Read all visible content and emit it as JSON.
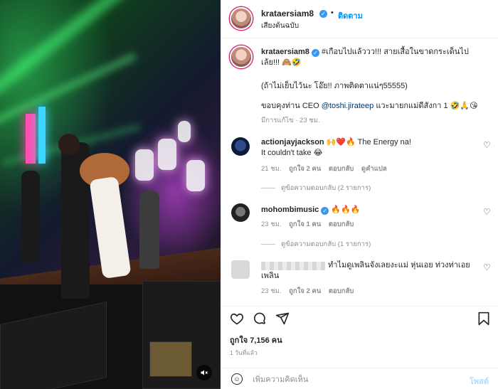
{
  "post": {
    "username": "krataersiam8",
    "follow_label": "ติดตาม",
    "audio_label": "เสียงต้นฉบับ",
    "caption": {
      "username": "krataersiam8",
      "line1": "#เกือบไปแล้ววว!!! สายเสื้อในขาดกระเด็นไป",
      "line2": "เล้ย!!! 🙈🤣",
      "line3": "(ถ้าไม่เย็บไว้นะ โอ๊ย!! ภาพติดตาแน่ๆ55555)",
      "line4_prefix": "ขอบคุงท่าน CEO ",
      "line4_mention": "@toshi.jirateep",
      "line4_suffix": " แวะมายกแม่ดีสังกา 1 🤣🙏😘",
      "meta": "มีการแก้ไข · 23 ชม."
    },
    "likes": "ถูกใจ 7,156 คน",
    "posted_time": "1 วันที่แล้ว"
  },
  "comments": [
    {
      "username": "actionjayjackson",
      "text_line1": "🙌❤️🔥 The Energy na!",
      "text_line2": "It couldn't take 😂",
      "time": "21 ชม.",
      "likes": "ถูกใจ 2 คน",
      "reply": "ตอบกลับ",
      "translate": "ดูคำแปล",
      "view_replies": "ดูข้อความตอบกลับ (2 รายการ)"
    },
    {
      "username": "mohombimusic",
      "text_line1": "🔥🔥🔥",
      "time": "23 ชม.",
      "likes": "ถูกใจ 1 คน",
      "reply": "ตอบกลับ",
      "view_replies": "ดูข้อความตอบกลับ (1 รายการ)"
    },
    {
      "text_line1": "ทำไมดูเพลินจังเลยงะแม่ หุ่นเอย ท่วงท่าเอย",
      "text_line2": "เพลิน",
      "time": "23 ชม.",
      "likes": "ถูกใจ 2 คน",
      "reply": "ตอบกลับ"
    }
  ],
  "comment_input": {
    "placeholder": "เพิ่มความคิดเห็น",
    "post_label": "โพสต์"
  },
  "icons": {
    "like": "heart-icon",
    "comment": "comment-icon",
    "share": "share-icon",
    "save": "bookmark-icon",
    "emoji": "emoji-icon",
    "mute": "mute-icon",
    "verified": "verified-badge-icon"
  },
  "colors": {
    "accent": "#0095f6",
    "verified": "#3897f0",
    "post_disabled": "#b3dbff"
  }
}
